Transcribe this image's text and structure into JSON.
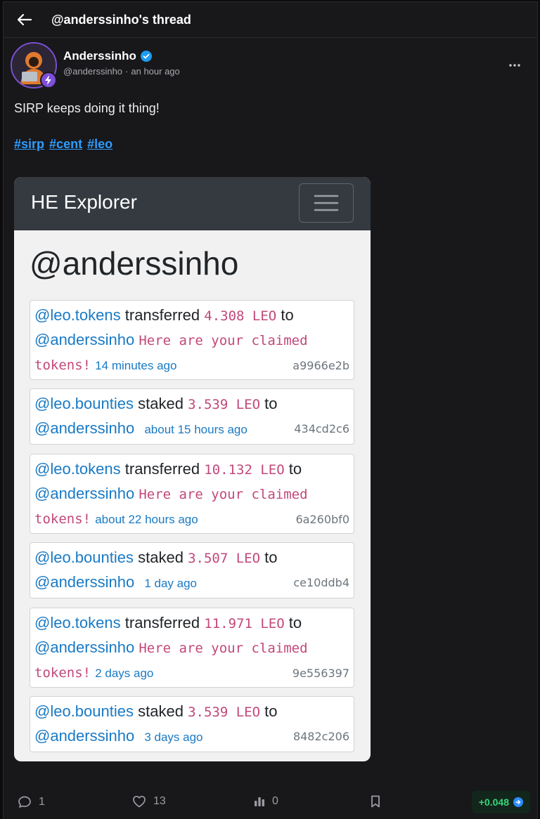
{
  "header": {
    "title": "@anderssinho's thread"
  },
  "post": {
    "author": "Anderssinho",
    "handle": "@anderssinho",
    "time": "an hour ago",
    "text": "SIRP keeps doing it thing!",
    "tags": [
      "#sirp",
      "#cent",
      "#leo"
    ]
  },
  "embedded_image": {
    "brand": "HE Explorer",
    "heading": "@anderssinho",
    "transactions": [
      {
        "from": "@leo.tokens",
        "action": "transferred",
        "amount": "4.308 LEO",
        "to_word": "to",
        "to": "@anderssinho",
        "memo": "Here are your claimed",
        "memo2": "tokens!",
        "time": "14 minutes ago",
        "hash": "a9966e2b"
      },
      {
        "from": "@leo.bounties",
        "action": "staked",
        "amount": "3.539 LEO",
        "to_word": "to",
        "to": "@anderssinho",
        "time": "about 15 hours ago",
        "hash": "434cd2c6"
      },
      {
        "from": "@leo.tokens",
        "action": "transferred",
        "amount": "10.132 LEO",
        "to_word": "to",
        "to": "@anderssinho",
        "memo": "Here are your claimed",
        "memo2": "tokens!",
        "time": "about 22 hours ago",
        "hash": "6a260bf0"
      },
      {
        "from": "@leo.bounties",
        "action": "staked",
        "amount": "3.507 LEO",
        "to_word": "to",
        "to": "@anderssinho",
        "time": "1 day ago",
        "hash": "ce10ddb4"
      },
      {
        "from": "@leo.tokens",
        "action": "transferred",
        "amount": "11.971 LEO",
        "to_word": "to",
        "to": "@anderssinho",
        "memo": "Here are your claimed",
        "memo2": "tokens!",
        "time": "2 days ago",
        "hash": "9e556397"
      },
      {
        "from": "@leo.bounties",
        "action": "staked",
        "amount": "3.539 LEO",
        "to_word": "to",
        "to": "@anderssinho",
        "time": "3 days ago",
        "hash": "8482c206"
      }
    ]
  },
  "actions": {
    "comments": "1",
    "likes": "13",
    "votes": "0",
    "payout": "+0.048"
  },
  "colors": {
    "accent_link": "#2f9cff",
    "payout_green": "#36d67a",
    "badge_purple": "#7d4fd9"
  }
}
